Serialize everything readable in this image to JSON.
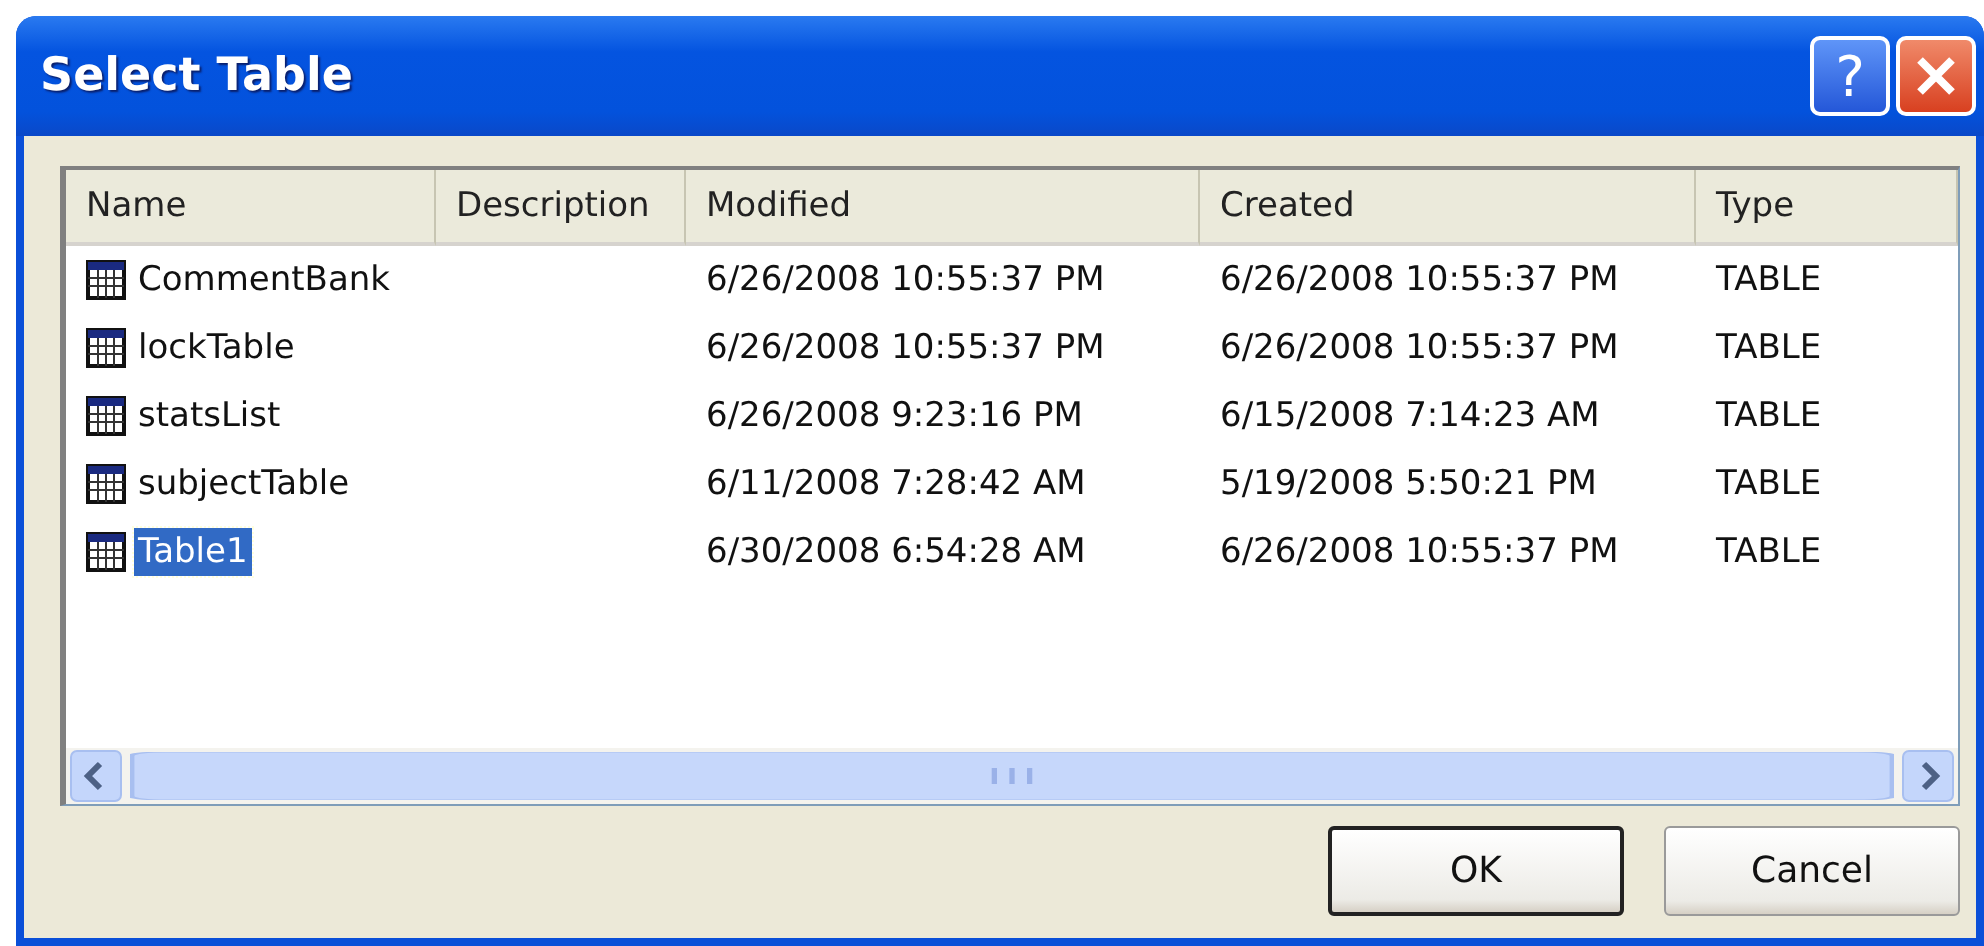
{
  "window": {
    "title": "Select Table",
    "help_button": "?"
  },
  "table": {
    "columns": [
      "Name",
      "Description",
      "Modified",
      "Created",
      "Type"
    ],
    "rows": [
      {
        "cells": [
          "CommentBank",
          "",
          "6/26/2008 10:55:37 PM",
          "6/26/2008 10:55:37 PM",
          "TABLE"
        ],
        "selected": false
      },
      {
        "cells": [
          "lockTable",
          "",
          "6/26/2008 10:55:37 PM",
          "6/26/2008 10:55:37 PM",
          "TABLE"
        ],
        "selected": false
      },
      {
        "cells": [
          "statsList",
          "",
          "6/26/2008 9:23:16 PM",
          "6/15/2008 7:14:23 AM",
          "TABLE"
        ],
        "selected": false
      },
      {
        "cells": [
          "subjectTable",
          "",
          "6/11/2008 7:28:42 AM",
          "5/19/2008 5:50:21 PM",
          "TABLE"
        ],
        "selected": false
      },
      {
        "cells": [
          "Table1",
          "",
          "6/30/2008 6:54:28 AM",
          "6/26/2008 10:55:37 PM",
          "TABLE"
        ],
        "selected": true
      }
    ]
  },
  "buttons": [
    {
      "label": "OK",
      "default": true
    },
    {
      "label": "Cancel",
      "default": false
    }
  ]
}
